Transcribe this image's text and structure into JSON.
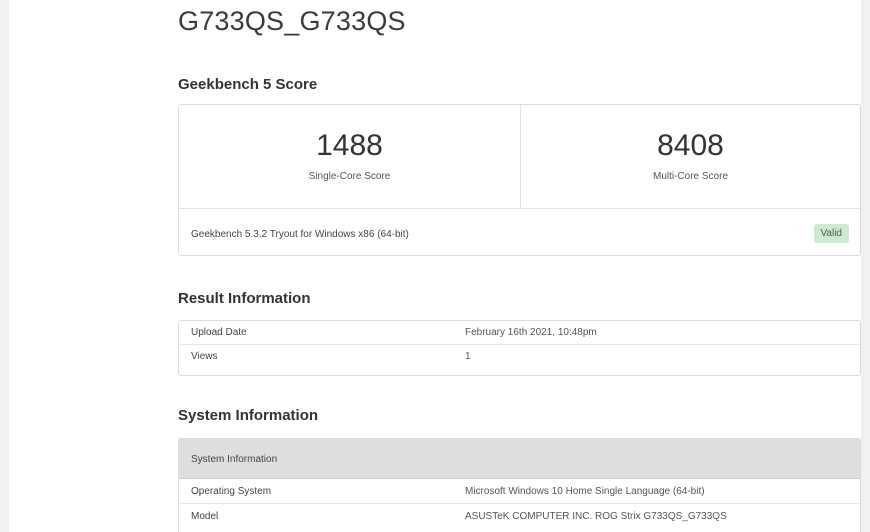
{
  "device_title": "G733QS_G733QS",
  "geekbench": {
    "heading": "Geekbench 5 Score",
    "single_core": {
      "value": "1488",
      "label": "Single-Core Score"
    },
    "multi_core": {
      "value": "8408",
      "label": "Multi-Core Score"
    },
    "version": "Geekbench 5.3.2 Tryout for Windows x86 (64-bit)",
    "status": "Valid"
  },
  "result_info": {
    "heading": "Result Information",
    "rows": [
      {
        "key": "Upload Date",
        "value": "February 16th 2021, 10:48pm"
      },
      {
        "key": "Views",
        "value": "1"
      }
    ]
  },
  "system_info": {
    "heading": "System Information",
    "table_header": "System Information",
    "rows": [
      {
        "key": "Operating System",
        "value": "Microsoft Windows 10 Home Single Language (64-bit)"
      },
      {
        "key": "Model",
        "value": "ASUSTeK COMPUTER INC. ROG Strix G733QS_G733QS"
      }
    ]
  },
  "colors": {
    "valid_badge_bg": "#cfe8cf",
    "valid_badge_text": "#3b6b3b",
    "table_header_bg": "#dedede"
  }
}
